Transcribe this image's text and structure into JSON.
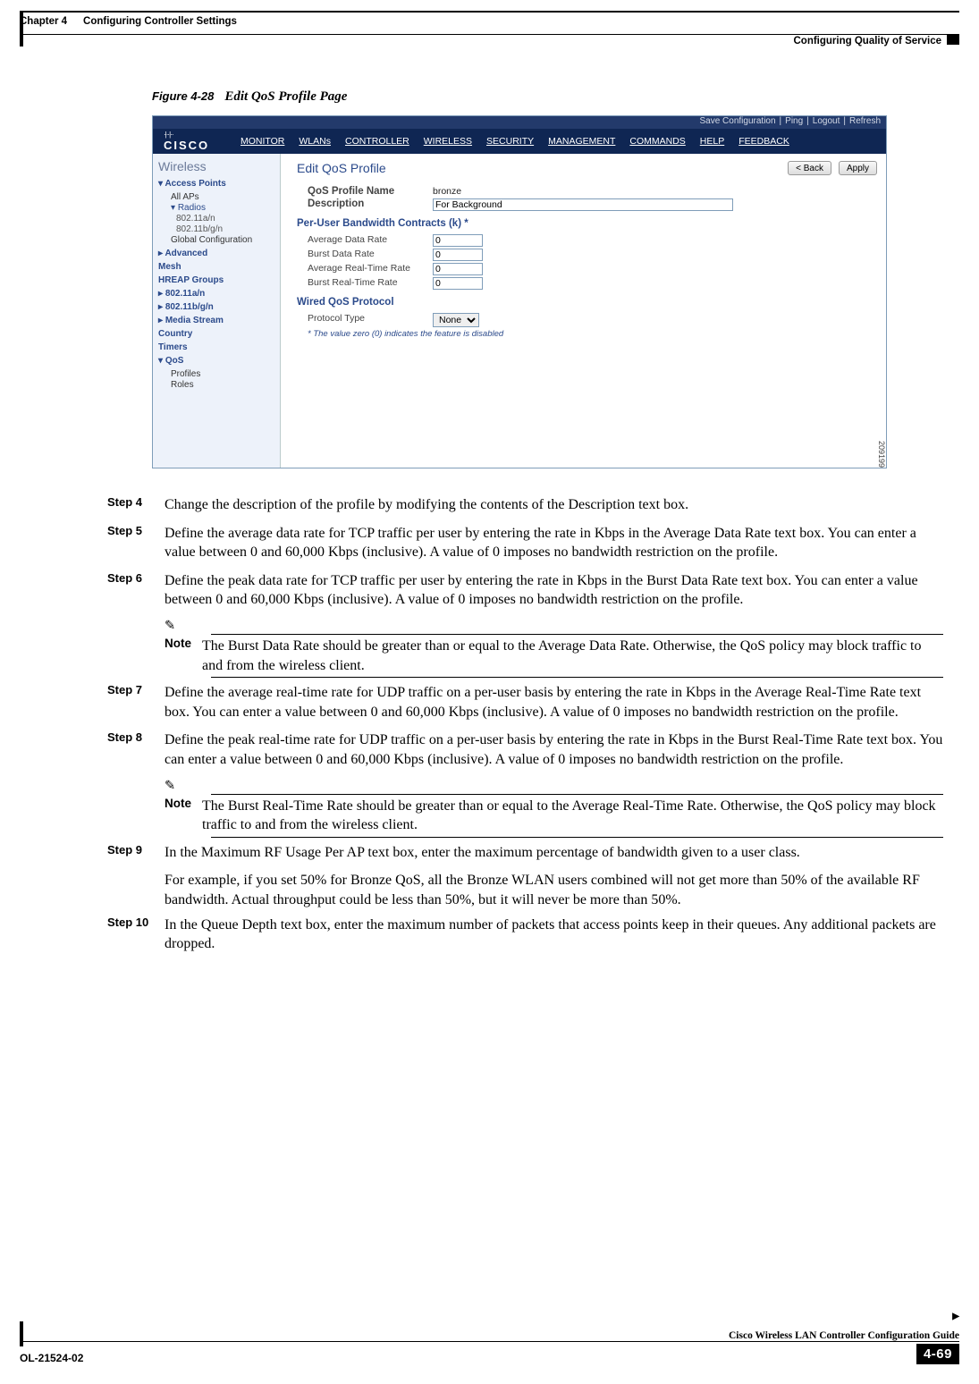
{
  "header": {
    "chapter": "Chapter 4",
    "title": "Configuring Controller Settings",
    "section": "Configuring Quality of Service"
  },
  "figure": {
    "number": "Figure 4-28",
    "title": "Edit QoS Profile Page"
  },
  "screenshot": {
    "logo": "CISCO",
    "id": "209199",
    "topbar": [
      "Save Configuration",
      "Ping",
      "Logout",
      "Refresh"
    ],
    "nav": [
      "MONITOR",
      "WLANs",
      "CONTROLLER",
      "WIRELESS",
      "SECURITY",
      "MANAGEMENT",
      "COMMANDS",
      "HELP",
      "FEEDBACK"
    ],
    "sidebar": {
      "title": "Wireless",
      "ap": "Access Points",
      "allaps": "All APs",
      "radios": "Radios",
      "r1": "802.11a/n",
      "r2": "802.11b/g/n",
      "gc": "Global Configuration",
      "adv": "Advanced",
      "mesh": "Mesh",
      "hreap": "HREAP Groups",
      "s11a": "802.11a/n",
      "s11b": "802.11b/g/n",
      "media": "Media Stream",
      "country": "Country",
      "timers": "Timers",
      "qos": "QoS",
      "profiles": "Profiles",
      "roles": "Roles"
    },
    "main": {
      "heading": "Edit QoS Profile",
      "back": "< Back",
      "apply": "Apply",
      "fields": [
        {
          "label": "QoS Profile Name",
          "value": "bronze"
        },
        {
          "label": "Description",
          "value": "For Background"
        }
      ],
      "bwsection": "Per-User Bandwidth Contracts (k) *",
      "bw": [
        {
          "label": "Average Data Rate",
          "value": "0"
        },
        {
          "label": "Burst Data Rate",
          "value": "0"
        },
        {
          "label": "Average Real-Time Rate",
          "value": "0"
        },
        {
          "label": "Burst Real-Time Rate",
          "value": "0"
        }
      ],
      "wiresection": "Wired QoS Protocol",
      "wire": [
        {
          "label": "Protocol Type",
          "value": "None"
        }
      ],
      "foot": "* The value zero (0) indicates the feature is disabled"
    }
  },
  "steps": [
    {
      "num": "Step 4",
      "text": "Change the description of the profile by modifying the contents of the Description text box."
    },
    {
      "num": "Step 5",
      "text": "Define the average data rate for TCP traffic per user by entering the rate in Kbps in the Average Data Rate text box. You can enter a value between 0 and 60,000 Kbps (inclusive). A value of 0 imposes no bandwidth restriction on the profile."
    },
    {
      "num": "Step 6",
      "text": "Define the peak data rate for TCP traffic per user by entering the rate in Kbps in the Burst Data Rate text box. You can enter a value between 0 and 60,000 Kbps (inclusive). A value of 0 imposes no bandwidth restriction on the profile."
    },
    {
      "num": "Step 7",
      "text": "Define the average real-time rate for UDP traffic on a per-user basis by entering the rate in Kbps in the Average Real-Time Rate text box. You can enter a value between 0 and 60,000 Kbps (inclusive). A value of 0 imposes no bandwidth restriction on the profile."
    },
    {
      "num": "Step 8",
      "text": "Define the peak real-time rate for UDP traffic on a per-user basis by entering the rate in Kbps in the Burst Real-Time Rate text box. You can enter a value between 0 and 60,000 Kbps (inclusive). A value of 0 imposes no bandwidth restriction on the profile."
    },
    {
      "num": "Step 9",
      "text": "In the Maximum RF Usage Per AP text box, enter the maximum percentage of bandwidth given to a user class.",
      "extra": "For example, if you set 50% for Bronze QoS, all the Bronze WLAN users combined will not get more than 50% of the available RF bandwidth. Actual throughput could be less than 50%, but it will never be more than 50%."
    },
    {
      "num": "Step 10",
      "text": "In the Queue Depth text box, enter the maximum number of packets that access points keep in their queues. Any additional packets are dropped."
    }
  ],
  "notes": {
    "label": "Note",
    "0": "The Burst Data Rate should be greater than or equal to the Average Data Rate. Otherwise, the QoS policy may block traffic to and from the wireless client.",
    "1": "The Burst Real-Time Rate should be greater than or equal to the Average Real-Time Rate. Otherwise, the QoS policy may block traffic to and from the wireless client."
  },
  "footer": {
    "book": "Cisco Wireless LAN Controller Configuration Guide",
    "docid": "OL-21524-02",
    "page": "4-69"
  }
}
